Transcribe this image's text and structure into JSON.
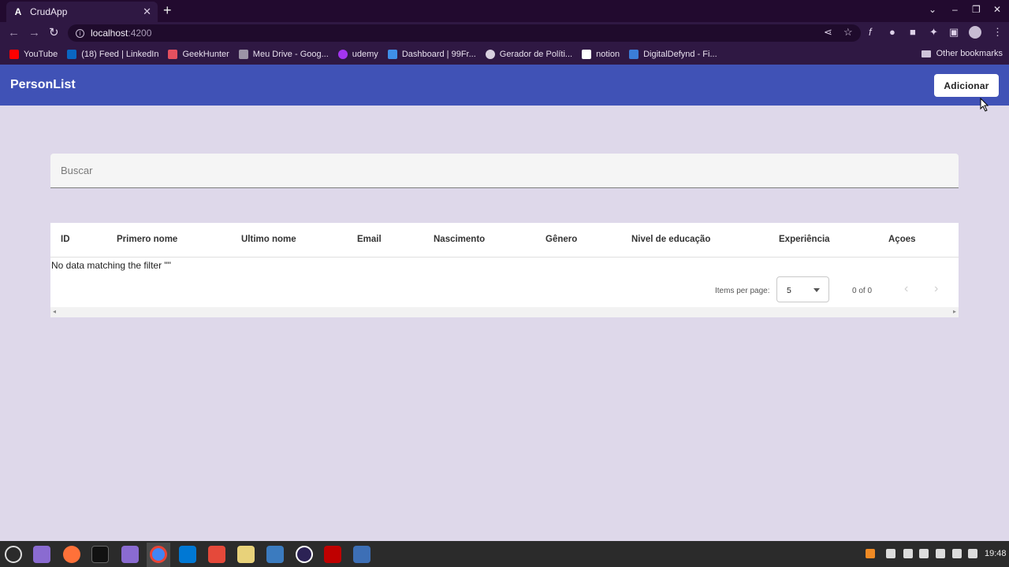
{
  "browser": {
    "tab_title": "CrudApp",
    "tab_favicon": "A",
    "close_glyph": "✕",
    "new_tab_glyph": "+",
    "url_host": "localhost",
    "url_port": ":4200",
    "bookmarks": [
      {
        "label": "YouTube",
        "icon": "youtube-icon",
        "color": "#ff0000"
      },
      {
        "label": "(18) Feed | LinkedIn",
        "icon": "linkedin-icon",
        "color": "#0a66c2"
      },
      {
        "label": "GeekHunter",
        "icon": "geekhunter-icon",
        "color": "#e5505f"
      },
      {
        "label": "Meu Drive - Goog...",
        "icon": "drive-icon",
        "color": "#9c94a6"
      },
      {
        "label": "udemy",
        "icon": "udemy-icon",
        "color": "#a435f0"
      },
      {
        "label": "Dashboard | 99Fr...",
        "icon": "dashboard-icon",
        "color": "#3f8fe8"
      },
      {
        "label": "Gerador de Políti...",
        "icon": "globe-icon",
        "color": "#d8d0df"
      },
      {
        "label": "notion",
        "icon": "notion-icon",
        "color": "#ffffff"
      },
      {
        "label": "DigitalDefynd - Fi...",
        "icon": "digitaldefynd-icon",
        "color": "#3b7dd8"
      }
    ],
    "other_bookmarks": "Other bookmarks"
  },
  "app": {
    "title": "PersonList",
    "add_button": "Adicionar",
    "accent_color": "#4052b6",
    "search_placeholder": "Buscar",
    "columns": [
      "ID",
      "Primero nome",
      "Ultimo nome",
      "Email",
      "Nascimento",
      "Gênero",
      "Nivel de educação",
      "Experiência",
      "Açoes"
    ],
    "no_data": "No data matching the filter \"\"",
    "paginator": {
      "items_per_page_label": "Items per page:",
      "page_size": "5",
      "range": "0 of 0",
      "prev_glyph": "‹",
      "next_glyph": "›"
    }
  },
  "taskbar": {
    "clock": "19:48",
    "apps": [
      "menu-icon",
      "files-icon",
      "firefox-icon",
      "terminal-icon",
      "folder-icon",
      "chrome-icon",
      "vscode-icon",
      "git-icon",
      "settings-icon",
      "mysql-icon",
      "eclipse-icon",
      "filezilla-icon",
      "camera-icon"
    ]
  }
}
